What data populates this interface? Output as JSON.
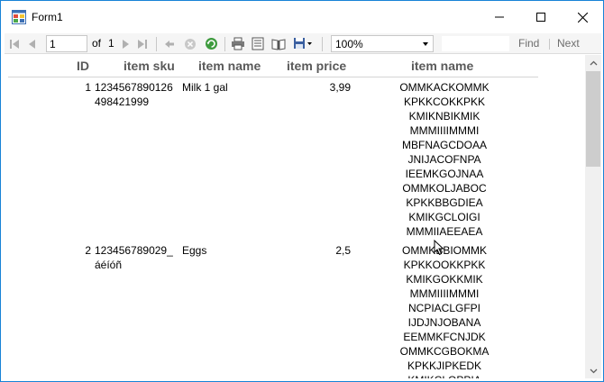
{
  "window": {
    "title": "Form1"
  },
  "toolbar": {
    "page_value": "1",
    "of_label": "of",
    "total_pages": "1",
    "zoom_value": "100%",
    "find_label": "Find",
    "next_label": "Next"
  },
  "report": {
    "headers": [
      "ID",
      "item sku",
      "item name",
      "item price",
      "item name"
    ],
    "rows": [
      {
        "id": "1",
        "sku_line1": "1234567890126",
        "sku_line2": "498421999",
        "name": "Milk 1 gal",
        "price": "3,99",
        "code_lines": [
          "OMMKACKOMMK",
          "KPKKCOKKPKK",
          "KMIKNBIKMIK",
          "MMMIIIIMMMI",
          "MBFNAGCDOAA",
          "JNIJACOFNPA",
          "IEEMKGOJNAA",
          "OMMKOLJABOC",
          "KPKKBBGDIEA",
          "KMIKGCLOIGI",
          "MMMIIAEEAEA"
        ]
      },
      {
        "id": "2",
        "sku_line1": "123456789029_",
        "sku_line2": "áéíóñ",
        "name": "Eggs",
        "price": "2,5",
        "code_lines": [
          "OMMKBBIOMMK",
          "KPKKOOKKPKK",
          "KMIKGOKKMIK",
          "MMMIIIIMMMI",
          "NCPIACLGFPI",
          "IJDJNJOBANA",
          "EEMMKFCNJDK",
          "OMMKCGBOKMA",
          "KPKKJIPKEDK",
          "KMIKCLOPPIA"
        ]
      }
    ]
  },
  "colors": {
    "window_border": "#1883d7",
    "toolbar_bg": "#f5f5f5",
    "header_text": "#5a5a5a"
  }
}
